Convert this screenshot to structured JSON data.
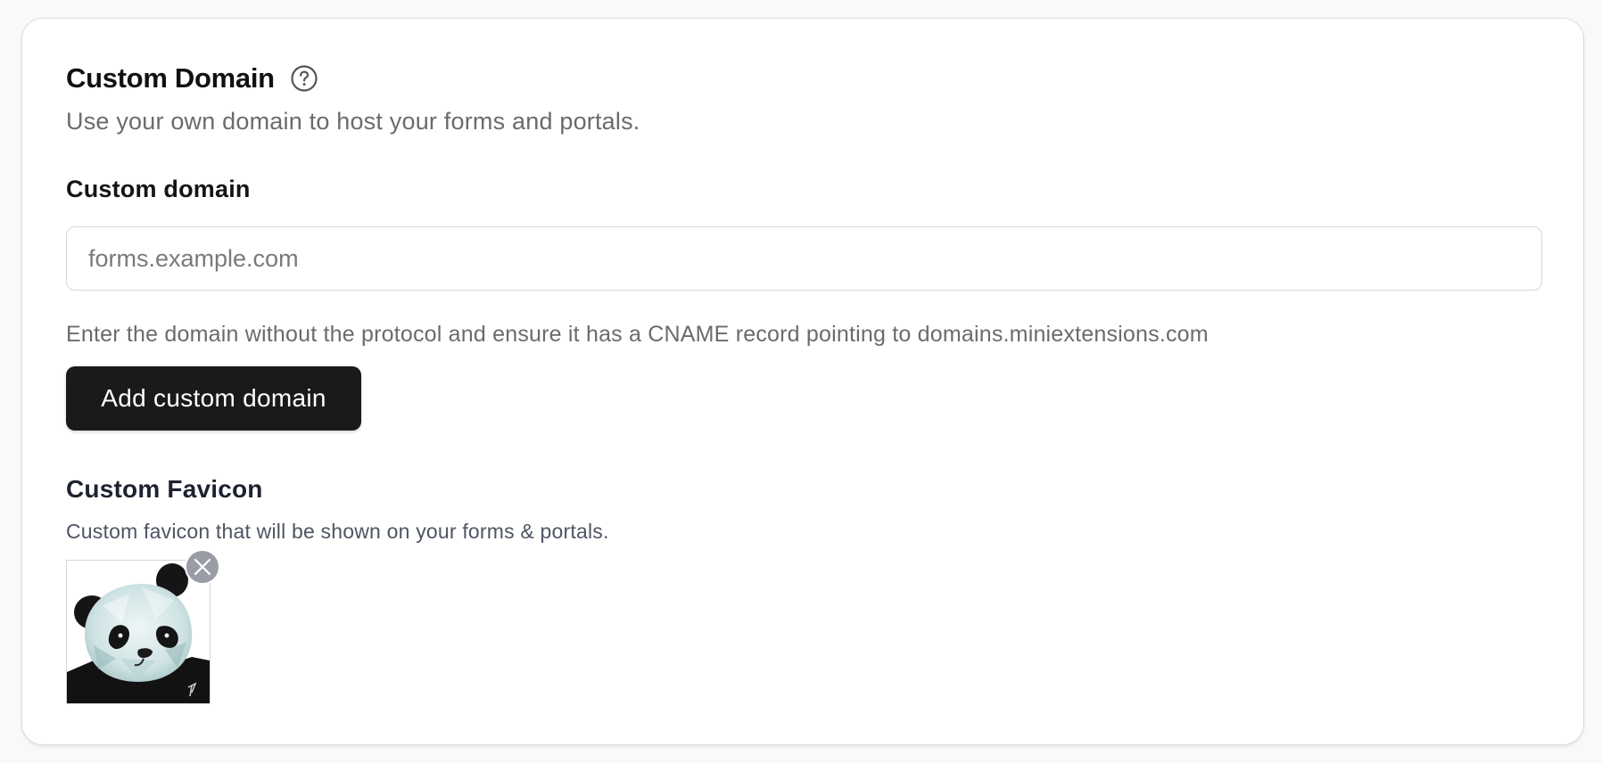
{
  "section": {
    "title": "Custom Domain",
    "help_icon": "question-circle-icon",
    "subtitle": "Use your own domain to host your forms and portals."
  },
  "domain_field": {
    "label": "Custom domain",
    "value": "",
    "placeholder": "forms.example.com",
    "help_text": "Enter the domain without the protocol and ensure it has a CNAME record pointing to domains.miniextensions.com"
  },
  "add_button": {
    "label": "Add custom domain"
  },
  "favicon": {
    "title": "Custom Favicon",
    "description": "Custom favicon that will be shown on your forms & portals.",
    "image_icon": "panda-image",
    "remove_icon": "close-icon"
  },
  "colors": {
    "button_bg": "#1a1a1a",
    "button_text": "#ffffff",
    "remove_badge": "#9a9da5"
  }
}
